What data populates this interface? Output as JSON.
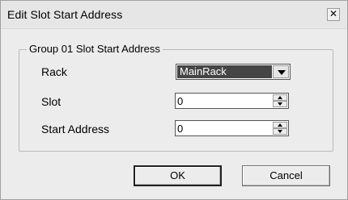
{
  "window": {
    "title": "Edit Slot Start Address",
    "close_glyph": "✕"
  },
  "group": {
    "legend": "Group 01 Slot Start Address"
  },
  "fields": {
    "rack": {
      "label": "Rack",
      "value": "MainRack"
    },
    "slot": {
      "label": "Slot",
      "value": "0"
    },
    "start_address": {
      "label": "Start Address",
      "value": "0"
    }
  },
  "buttons": {
    "ok": "OK",
    "cancel": "Cancel"
  }
}
